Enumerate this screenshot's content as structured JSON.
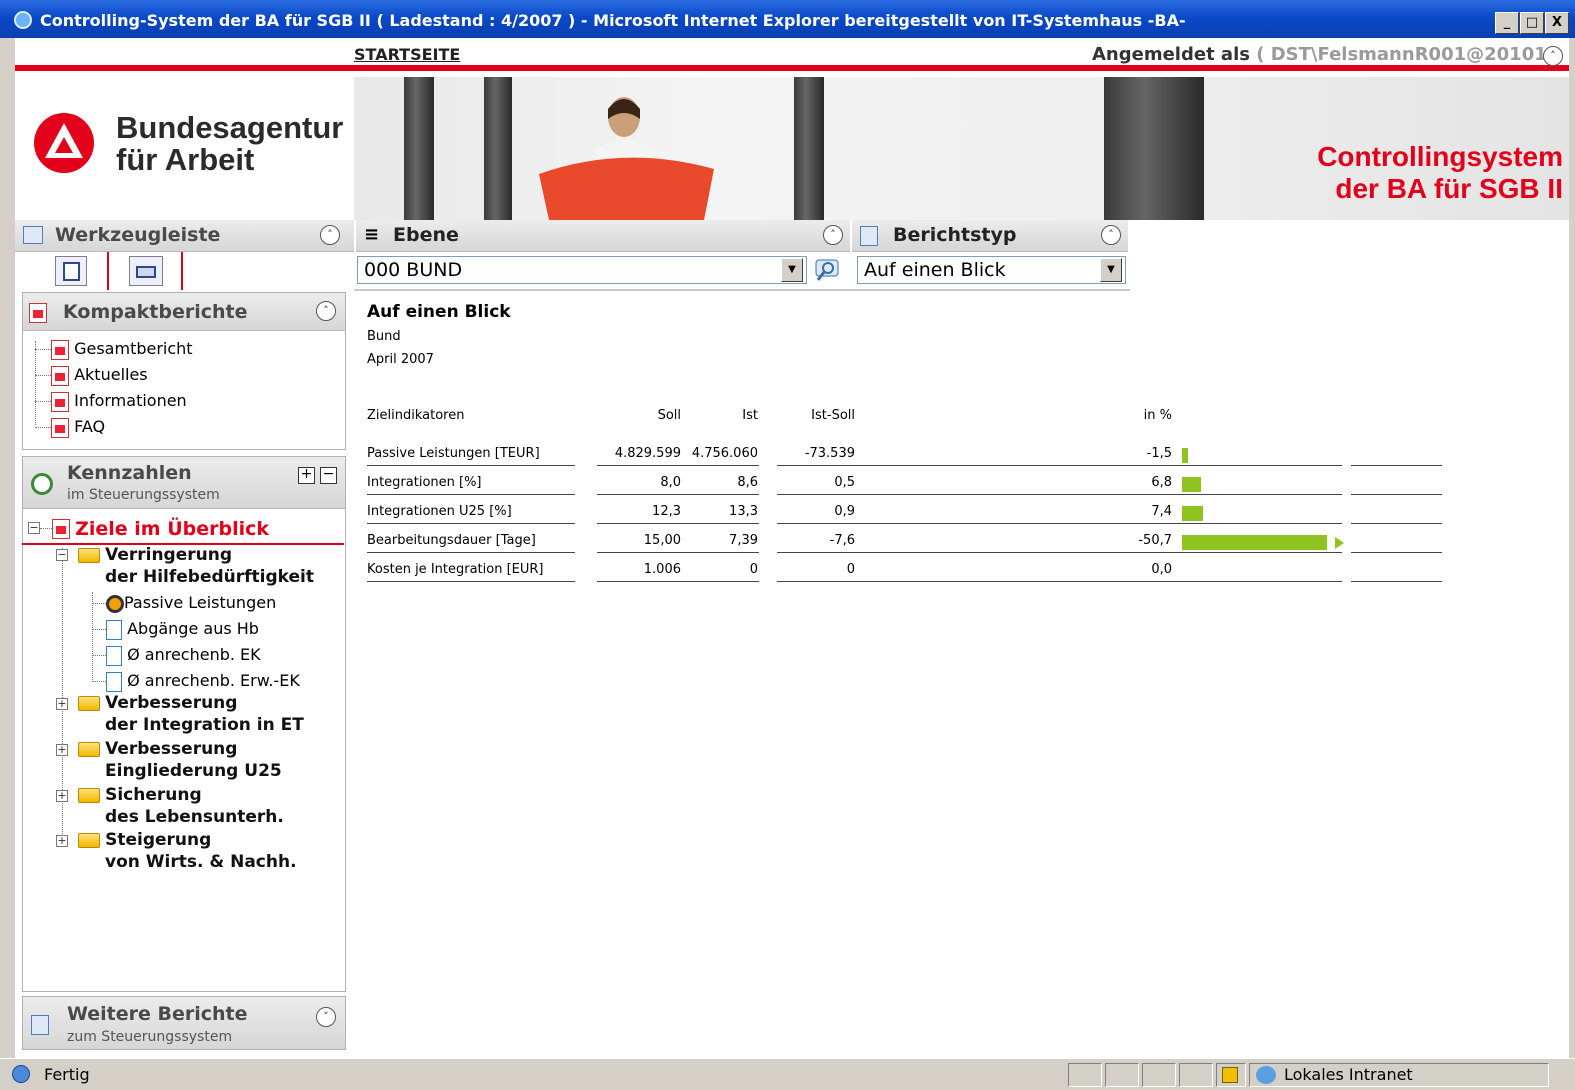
{
  "window": {
    "title": "Controlling-System der BA für SGB II ( Ladestand : 4/2007 ) - Microsoft Internet Explorer bereitgestellt von IT-Systemhaus -BA-",
    "minimize": "_",
    "maximize": "□",
    "close": "X"
  },
  "topnav": {
    "startseite": "STARTSEITE ",
    "logged_in_label": "Angemeldet als",
    "user": "( DST\\FelsmannR001@20101 )",
    "collapse_glyph": "˄"
  },
  "branding": {
    "org_line1": "Bundesagentur",
    "org_line2": "für Arbeit",
    "system_line1": "Controllingsystem",
    "system_line2": "der BA für SGB II"
  },
  "werkzeugleiste": {
    "title": "Werkzeugleiste"
  },
  "kompaktberichte": {
    "title": "Kompaktberichte",
    "items": [
      "Gesamtbericht",
      "Aktuelles",
      "Informationen",
      "FAQ"
    ]
  },
  "kennzahlen": {
    "title": "Kennzahlen",
    "subtitle": "im Steuerungssystem",
    "plus": "+",
    "minus": "−",
    "root": "Ziele im Überblick",
    "groups": [
      {
        "line1": "Verringerung",
        "line2": "der Hilfebedürftigkeit"
      },
      {
        "line1": "Verbesserung",
        "line2": "der Integration in ET"
      },
      {
        "line1": "Verbesserung",
        "line2": "Eingliederung U25"
      },
      {
        "line1": "Sicherung",
        "line2": "des Lebensunterh."
      },
      {
        "line1": "Steigerung",
        "line2": "von Wirts. & Nachh."
      }
    ],
    "children": [
      "Passive Leistungen",
      "Abgänge aus Hb",
      "Ø anrechenb. EK",
      "Ø anrechenb. Erw.-EK"
    ]
  },
  "weitere": {
    "title": "Weitere Berichte",
    "subtitle": "zum Steuerungssystem"
  },
  "ebene": {
    "title": "Ebene",
    "value": "000 BUND"
  },
  "berichtstyp": {
    "title": "Berichtstyp",
    "value": "Auf einen Blick"
  },
  "report": {
    "title": "Auf einen Blick",
    "region": "Bund",
    "period": "April 2007",
    "headers": {
      "indicator": "Zielindikatoren",
      "soll": "Soll",
      "ist": "Ist",
      "diff": "Ist-Soll",
      "pct": "in %"
    },
    "rows": [
      {
        "name": "Passive Leistungen [TEUR]",
        "soll": "4.829.599",
        "ist": "4.756.060",
        "diff": "-73.539",
        "pct": "-1,5",
        "pct_value": -1.5
      },
      {
        "name": "Integrationen [%]",
        "soll": "8,0",
        "ist": "8,6",
        "diff": "0,5",
        "pct": "6,8",
        "pct_value": 6.8
      },
      {
        "name": "Integrationen U25 [%]",
        "soll": "12,3",
        "ist": "13,3",
        "diff": "0,9",
        "pct": "7,4",
        "pct_value": 7.4
      },
      {
        "name": "Bearbeitungsdauer [Tage]",
        "soll": "15,00",
        "ist": "7,39",
        "diff": "-7,6",
        "pct": "-50,7",
        "pct_value": -50.7
      },
      {
        "name": "Kosten je Integration [EUR]",
        "soll": "1.006",
        "ist": "0",
        "diff": "0",
        "pct": "0,0",
        "pct_value": 0.0
      }
    ],
    "bar_color": "#8fc31f"
  },
  "statusbar": {
    "status": "Fertig",
    "zone": "Lokales Intranet"
  },
  "colors": {
    "brand_red": "#e2001a",
    "title_blue": "#0a49c8"
  }
}
